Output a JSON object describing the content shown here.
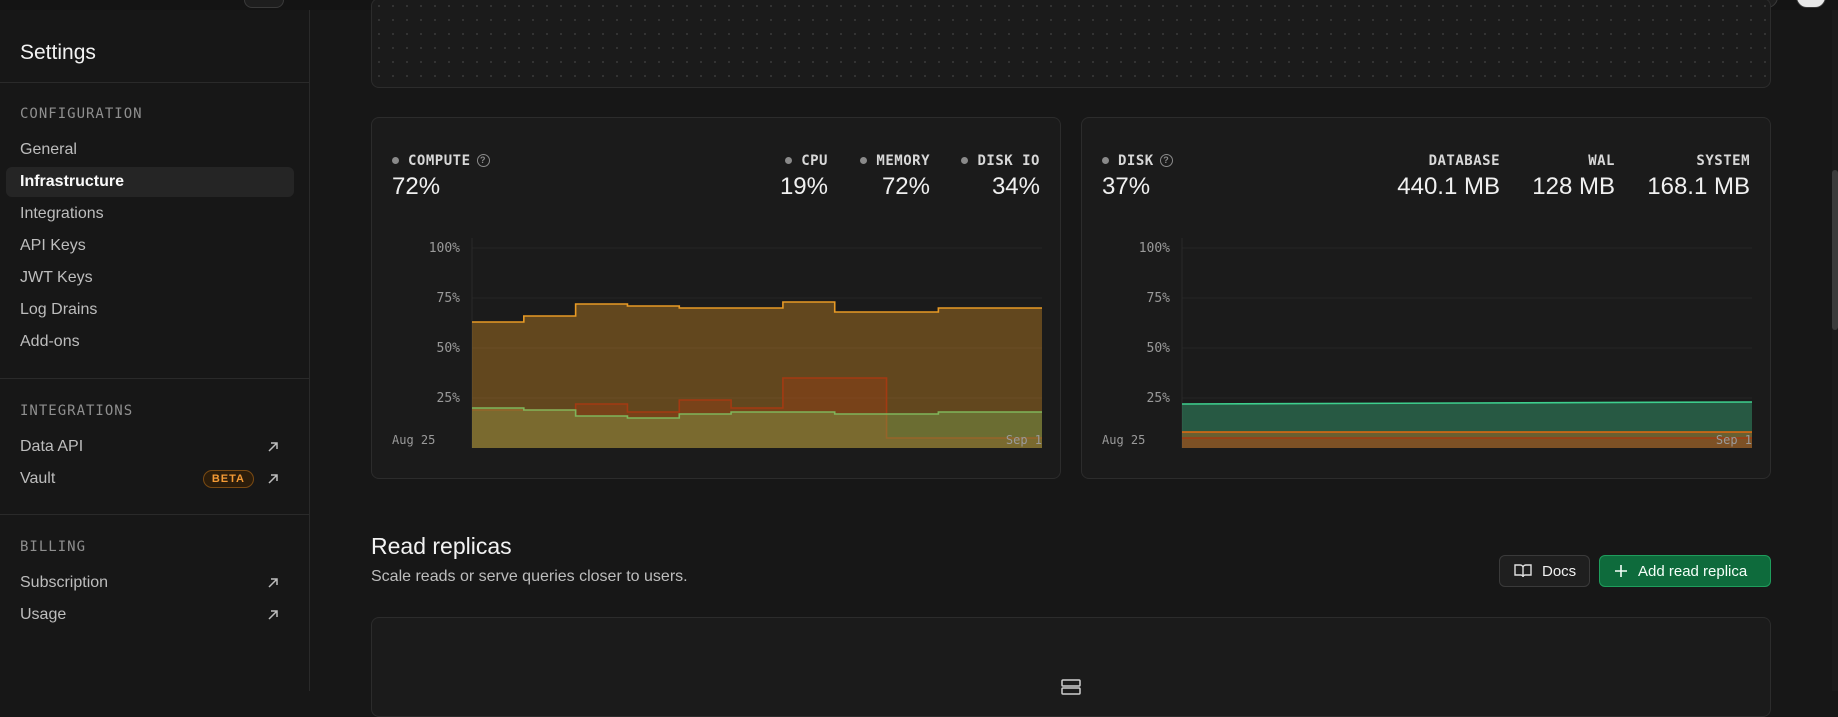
{
  "sidebar": {
    "title": "Settings",
    "sections": [
      {
        "heading": "CONFIGURATION",
        "items": [
          {
            "label": "General"
          },
          {
            "label": "Infrastructure",
            "active": true
          },
          {
            "label": "Integrations"
          },
          {
            "label": "API Keys"
          },
          {
            "label": "JWT Keys"
          },
          {
            "label": "Log Drains"
          },
          {
            "label": "Add-ons"
          }
        ]
      },
      {
        "heading": "INTEGRATIONS",
        "items": [
          {
            "label": "Data API",
            "icon": "external-link-icon"
          },
          {
            "label": "Vault",
            "badge": "BETA",
            "icon": "external-link-icon"
          }
        ]
      },
      {
        "heading": "BILLING",
        "items": [
          {
            "label": "Subscription",
            "icon": "external-link-icon"
          },
          {
            "label": "Usage",
            "icon": "external-link-icon"
          }
        ]
      }
    ]
  },
  "compute": {
    "label": "COMPUTE",
    "value": "72%",
    "metrics": [
      {
        "label": "CPU",
        "value": "19%"
      },
      {
        "label": "MEMORY",
        "value": "72%"
      },
      {
        "label": "DISK IO",
        "value": "34%"
      }
    ]
  },
  "disk": {
    "label": "DISK",
    "value": "37%",
    "metrics": [
      {
        "label": "DATABASE",
        "value": "440.1 MB"
      },
      {
        "label": "WAL",
        "value": "128 MB"
      },
      {
        "label": "SYSTEM",
        "value": "168.1 MB"
      }
    ]
  },
  "colors": {
    "memory": "#e89a25",
    "cpu": "#7fb55a",
    "disk_io": "#a33a12",
    "database": "#3ecf8e",
    "wal": "#e46a10",
    "system": "#a33a12",
    "accent_green": "#0e6b3c"
  },
  "chart_data": [
    {
      "type": "area",
      "ylim": [
        0,
        100
      ],
      "yticks": [
        "100%",
        "75%",
        "50%",
        "25%"
      ],
      "x_start_label": "Aug 25",
      "x_end_label": "Sep 1",
      "series": [
        {
          "name": "MEMORY",
          "values": [
            63,
            66,
            72,
            71,
            70,
            70,
            73,
            68,
            68,
            70,
            70
          ]
        },
        {
          "name": "DISK IO",
          "values": [
            19,
            19,
            22,
            18,
            24,
            20,
            35,
            35,
            5,
            5,
            5
          ]
        },
        {
          "name": "CPU",
          "values": [
            20,
            19,
            16,
            15,
            17,
            18,
            18,
            17,
            17,
            18,
            18
          ]
        }
      ]
    },
    {
      "type": "area",
      "ylim": [
        0,
        100
      ],
      "yticks": [
        "100%",
        "75%",
        "50%",
        "25%"
      ],
      "x_start_label": "Aug 25",
      "x_end_label": "Sep 1",
      "series": [
        {
          "name": "DATABASE",
          "values": [
            22,
            22.5,
            23
          ]
        },
        {
          "name": "WAL",
          "values": [
            8,
            8,
            8
          ]
        },
        {
          "name": "SYSTEM",
          "values": [
            5,
            5,
            5
          ]
        }
      ]
    }
  ],
  "read_replicas": {
    "title": "Read replicas",
    "subtitle": "Scale reads or serve queries closer to users.",
    "docs_label": "Docs",
    "add_label": "Add read replica",
    "empty_icon": "database-icon"
  }
}
